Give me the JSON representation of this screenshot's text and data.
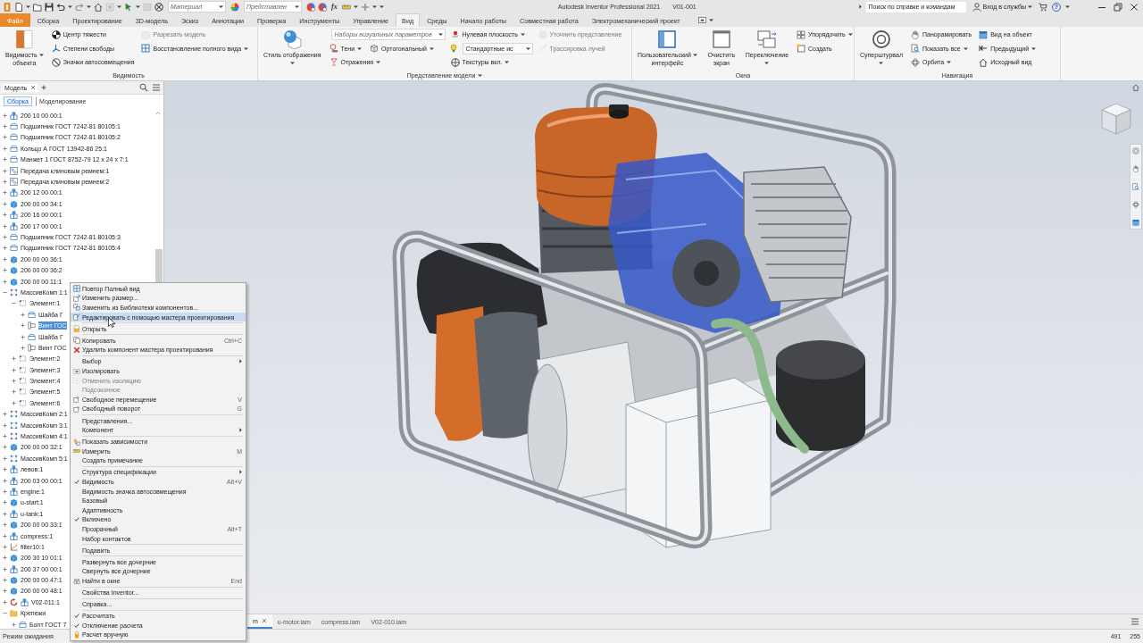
{
  "title_bar": {
    "quick_access": [
      {
        "kind": "button",
        "dropdown": true,
        "disabled": false
      },
      {
        "kind": "button",
        "dropdown": false,
        "disabled": false
      },
      {
        "kind": "button",
        "dropdown": false,
        "disabled": false
      },
      {
        "kind": "button",
        "dropdown": true,
        "disabled": false
      },
      {
        "kind": "button",
        "dropdown": true,
        "disabled": true
      },
      {
        "kind": "button",
        "dropdown": false,
        "disabled": false
      },
      {
        "kind": "button",
        "dropdown": true,
        "disabled": true
      },
      {
        "kind": "button",
        "dropdown": true,
        "disabled": false
      },
      {
        "kind": "button",
        "dropdown": false,
        "disabled": true
      },
      {
        "kind": "button",
        "dropdown": false,
        "disabled": false
      },
      {
        "kind": "combo",
        "placeholder": "Материал",
        "dropdown": true
      },
      {
        "kind": "button",
        "dropdown": false,
        "disabled": false
      },
      {
        "kind": "combo",
        "placeholder": "Представлен",
        "dropdown": true
      },
      {
        "kind": "button",
        "dropdown": false,
        "disabled": false
      },
      {
        "kind": "button",
        "dropdown": false,
        "disabled": false
      },
      {
        "kind": "text",
        "label": "fx"
      },
      {
        "kind": "button",
        "dropdown": true,
        "disabled": false
      },
      {
        "kind": "button",
        "dropdown": true,
        "disabled": true
      },
      {
        "kind": "menu"
      }
    ],
    "title": "Autodesk Inventor Professional 2021",
    "document": "V01-001",
    "search": {
      "placeholder": "Поиск по справке и командам"
    },
    "sign_in": "Вход в службы",
    "help": "?"
  },
  "ribbon_tabs": [
    {
      "label": "Файл",
      "kind": "file",
      "selected": false
    },
    {
      "label": "Сборка",
      "kind": "tab",
      "selected": false
    },
    {
      "label": "Проектирование",
      "kind": "tab",
      "selected": false
    },
    {
      "label": "3D-модель",
      "kind": "tab",
      "selected": false
    },
    {
      "label": "Эскиз",
      "kind": "tab",
      "selected": false
    },
    {
      "label": "Аннотации",
      "kind": "tab",
      "selected": false
    },
    {
      "label": "Проверка",
      "kind": "tab",
      "selected": false
    },
    {
      "label": "Инструменты",
      "kind": "tab",
      "selected": false
    },
    {
      "label": "Управление",
      "kind": "tab",
      "selected": false
    },
    {
      "label": "Вид",
      "kind": "tab",
      "selected": true
    },
    {
      "label": "Среды",
      "kind": "tab",
      "selected": false
    },
    {
      "label": "Начало работы",
      "kind": "tab",
      "selected": false
    },
    {
      "label": "Совместная работа",
      "kind": "tab",
      "selected": false
    },
    {
      "label": "Электромеханический проект",
      "kind": "tab",
      "selected": false
    }
  ],
  "ribbon_panels": [
    {
      "label": "Видимость",
      "dropdown": false,
      "columns": [
        {
          "rows": [
            [
              {
                "kind": "large",
                "lines": [
                  "Видимость",
                  "объекта"
                ],
                "dropdown": true,
                "disabled": false
              }
            ]
          ]
        },
        {
          "rows": [
            [
              {
                "kind": "small",
                "label": "Центр тяжести",
                "dropdown": false,
                "disabled": false
              }
            ],
            [
              {
                "kind": "small",
                "label": "Степени свободы",
                "dropdown": false,
                "disabled": false
              }
            ],
            [
              {
                "kind": "small",
                "label": "Значки автосовмещения",
                "dropdown": false,
                "disabled": false
              }
            ]
          ]
        },
        {
          "rows": [
            [
              {
                "kind": "small",
                "label": "Разрезать модель",
                "dropdown": false,
                "disabled": true
              }
            ],
            [
              {
                "kind": "small",
                "label": "Восстановление полного вида",
                "dropdown": true,
                "disabled": false
              }
            ]
          ]
        }
      ]
    },
    {
      "label": "Представление модели",
      "dropdown": true,
      "columns": [
        {
          "rows": [
            [
              {
                "kind": "large",
                "lines": [
                  "Стиль отображения"
                ],
                "dropdown": true,
                "disabled": false
              }
            ]
          ]
        },
        {
          "rows": [
            [
              {
                "kind": "combo",
                "placeholder": "Наборы визуальных параметров",
                "dropdown": true,
                "disabled": false
              }
            ],
            [
              {
                "kind": "small",
                "label": "Тени",
                "dropdown": true,
                "disabled": false
              },
              {
                "kind": "small",
                "label": "Ортогональный",
                "dropdown": true,
                "disabled": false
              }
            ],
            [
              {
                "kind": "small",
                "label": "Отражения",
                "dropdown": true,
                "disabled": false
              }
            ]
          ]
        },
        {
          "rows": [
            [
              {
                "kind": "small",
                "label": "Нулевая плоскость",
                "dropdown": true,
                "disabled": false
              }
            ],
            [
              {
                "kind": "combo",
                "value": "Стандартные ис",
                "dropdown": true,
                "disabled": false
              }
            ],
            [
              {
                "kind": "small",
                "label": "Текстуры вкл.",
                "dropdown": true,
                "disabled": false
              }
            ]
          ]
        },
        {
          "rows": [
            [
              {
                "kind": "small",
                "label": "Уточнить представление",
                "dropdown": false,
                "disabled": true
              }
            ],
            [
              {
                "kind": "small",
                "label": "Трассировка лучей",
                "dropdown": false,
                "disabled": true
              }
            ]
          ]
        }
      ]
    },
    {
      "label": "Окна",
      "dropdown": false,
      "columns": [
        {
          "rows": [
            [
              {
                "kind": "large",
                "lines": [
                  "Пользовательский",
                  "интерфейс"
                ],
                "dropdown": true,
                "disabled": false
              }
            ]
          ]
        },
        {
          "rows": [
            [
              {
                "kind": "large",
                "lines": [
                  "Очистить",
                  "экран"
                ],
                "dropdown": false,
                "disabled": false
              }
            ]
          ]
        },
        {
          "rows": [
            [
              {
                "kind": "large",
                "lines": [
                  "Переключение"
                ],
                "dropdown": true,
                "disabled": false
              }
            ]
          ]
        },
        {
          "rows": [
            [
              {
                "kind": "small",
                "label": "Упорядочить",
                "dropdown": true,
                "disabled": false
              }
            ],
            [
              {
                "kind": "small",
                "label": "Создать",
                "dropdown": false,
                "disabled": false
              }
            ]
          ]
        }
      ]
    },
    {
      "label": "Навигация",
      "dropdown": false,
      "columns": [
        {
          "rows": [
            [
              {
                "kind": "large",
                "lines": [
                  "Суперштурвал"
                ],
                "dropdown": true,
                "disabled": false
              }
            ]
          ]
        },
        {
          "rows": [
            [
              {
                "kind": "small",
                "label": "Панорамировать",
                "dropdown": false,
                "disabled": false
              }
            ],
            [
              {
                "kind": "small",
                "label": "Показать все",
                "dropdown": true,
                "disabled": false
              }
            ],
            [
              {
                "kind": "small",
                "label": "Орбита",
                "dropdown": true,
                "disabled": false
              }
            ]
          ]
        },
        {
          "rows": [
            [
              {
                "kind": "small",
                "label": "Вид на объект",
                "dropdown": false,
                "disabled": false
              }
            ],
            [
              {
                "kind": "small",
                "label": "Предыдущий",
                "dropdown": true,
                "disabled": false
              }
            ],
            [
              {
                "kind": "small",
                "label": "Исходный вид",
                "dropdown": false,
                "disabled": false
              }
            ]
          ]
        }
      ]
    }
  ],
  "browser": {
    "tabs": [
      {
        "label": "Модель",
        "selected": true
      }
    ],
    "views": [
      {
        "label": "Сборка",
        "selected": true
      },
      {
        "label": "Моделирование",
        "selected": false
      }
    ],
    "tree": [
      {
        "label": "200 10 00 00:1",
        "kind": "assembly",
        "expanded": false,
        "selected": false
      },
      {
        "label": "Подшипник ГОСТ 7242-81 80105:1",
        "kind": "library",
        "expanded": false,
        "selected": false
      },
      {
        "label": "Подшипник ГОСТ 7242-81 80105:2",
        "kind": "library",
        "expanded": false,
        "selected": false
      },
      {
        "label": "Кольцо А ГОСТ 13942-86 25:1",
        "kind": "library",
        "expanded": false,
        "selected": false
      },
      {
        "label": "Манжет 1 ГОСТ 8752-79 12 х 24 х 7:1",
        "kind": "library",
        "expanded": false,
        "selected": false
      },
      {
        "label": "Передача клиновым ремнем:1",
        "kind": "generator",
        "expanded": false,
        "selected": false
      },
      {
        "label": "Передача клиновым ремнем:2",
        "kind": "generator",
        "expanded": false,
        "selected": false
      },
      {
        "label": "200 12 00 00:1",
        "kind": "assembly",
        "expanded": false,
        "selected": false
      },
      {
        "label": "200 00 00 34:1",
        "kind": "part",
        "expanded": false,
        "selected": false
      },
      {
        "label": "200 16 00 00:1",
        "kind": "assembly",
        "expanded": false,
        "selected": false
      },
      {
        "label": "200 17 00 00:1",
        "kind": "assembly",
        "expanded": false,
        "selected": false
      },
      {
        "label": "Подшипник ГОСТ 7242-81 80105:3",
        "kind": "library",
        "expanded": false,
        "selected": false
      },
      {
        "label": "Подшипник ГОСТ 7242-81 80105:4",
        "kind": "library",
        "expanded": false,
        "selected": false
      },
      {
        "label": "200 00 00 36:1",
        "kind": "part",
        "expanded": false,
        "selected": false
      },
      {
        "label": "200 00 00 36:2",
        "kind": "part",
        "expanded": false,
        "selected": false
      },
      {
        "label": "200 00 00 11:1",
        "kind": "part",
        "expanded": false,
        "selected": false
      },
      {
        "label": "МассивКомп 1:1",
        "kind": "pattern",
        "expanded": true,
        "selected": false,
        "children": [
          {
            "label": "Элемент:1",
            "kind": "element",
            "expanded": true,
            "selected": false,
            "children": [
              {
                "label": "Шайба Г",
                "kind": "library",
                "expanded": false,
                "selected": false
              },
              {
                "label": "Винт ГОС",
                "kind": "bolt",
                "expanded": false,
                "selected": true
              },
              {
                "label": "Шайба Г",
                "kind": "library",
                "expanded": false,
                "selected": false
              },
              {
                "label": "Винт ГОС",
                "kind": "bolt",
                "expanded": false,
                "selected": false
              }
            ]
          },
          {
            "label": "Элемент:2",
            "kind": "element",
            "expanded": false,
            "selected": false
          },
          {
            "label": "Элемент:3",
            "kind": "element",
            "expanded": false,
            "selected": false
          },
          {
            "label": "Элемент:4",
            "kind": "element",
            "expanded": false,
            "selected": false
          },
          {
            "label": "Элемент:5",
            "kind": "element",
            "expanded": false,
            "selected": false
          },
          {
            "label": "Элемент:6",
            "kind": "element",
            "expanded": false,
            "selected": false
          }
        ]
      },
      {
        "label": "МассивКомп 2:1",
        "kind": "pattern",
        "expanded": false,
        "selected": false
      },
      {
        "label": "МассивКомп 3:1",
        "kind": "pattern",
        "expanded": false,
        "selected": false
      },
      {
        "label": "МассивКомп 4:1",
        "kind": "pattern",
        "expanded": false,
        "selected": false
      },
      {
        "label": "200 00 00 32:1",
        "kind": "part",
        "expanded": false,
        "selected": false
      },
      {
        "label": "МассивКомп 5:1",
        "kind": "pattern",
        "expanded": false,
        "selected": false
      },
      {
        "label": "левов:1",
        "kind": "assembly",
        "expanded": false,
        "selected": false
      },
      {
        "label": "200 03 00 00:1",
        "kind": "assembly",
        "expanded": false,
        "selected": false
      },
      {
        "label": "engine:1",
        "kind": "assembly",
        "expanded": false,
        "selected": false
      },
      {
        "label": "u-start:1",
        "kind": "part",
        "expanded": false,
        "selected": false
      },
      {
        "label": "u-tank:1",
        "kind": "assembly",
        "expanded": false,
        "selected": false
      },
      {
        "label": "200 00 00 33:1",
        "kind": "part",
        "expanded": false,
        "selected": false
      },
      {
        "label": "compress:1",
        "kind": "assembly",
        "expanded": false,
        "selected": false
      },
      {
        "label": "filter10:1",
        "kind": "curve",
        "expanded": false,
        "selected": false
      },
      {
        "label": "200 30 10 01:1",
        "kind": "part",
        "expanded": false,
        "selected": false
      },
      {
        "label": "200 37 00 00:1",
        "kind": "assembly",
        "expanded": false,
        "selected": false
      },
      {
        "label": "200 00 00 47:1",
        "kind": "part",
        "expanded": false,
        "selected": false
      },
      {
        "label": "200 00 00 48:1",
        "kind": "part",
        "expanded": false,
        "selected": false
      },
      {
        "label": "V02-011:1",
        "kind": "linked",
        "expanded": false,
        "selected": false
      },
      {
        "label": "Крепежи",
        "kind": "folder",
        "expanded": true,
        "selected": false,
        "children": [
          {
            "label": "Болт ГОСТ 7",
            "kind": "library",
            "expanded": false,
            "selected": false
          }
        ]
      }
    ]
  },
  "context_menu": {
    "groups": [
      [
        {
          "label": "Повтор Полный вид",
          "checked": false,
          "disabled": false,
          "selected": false,
          "submenu": false
        },
        {
          "label": "Изменить размер...",
          "checked": false,
          "disabled": false,
          "selected": false,
          "submenu": false
        },
        {
          "label": "Заменить из Библиотеки компонентов...",
          "checked": false,
          "disabled": false,
          "selected": false,
          "submenu": false
        },
        {
          "label": "Редактировать с помощью мастера проектирования",
          "checked": false,
          "disabled": false,
          "selected": true,
          "submenu": false
        }
      ],
      [
        {
          "label": "Открыть",
          "checked": false,
          "disabled": false,
          "selected": false,
          "submenu": false
        }
      ],
      [
        {
          "label": "Копировать",
          "shortcut": "Ctrl+C",
          "checked": false,
          "disabled": false,
          "selected": false,
          "submenu": false
        },
        {
          "label": "Удалить компонент мастера проектирования",
          "checked": false,
          "disabled": false,
          "selected": false,
          "submenu": false
        }
      ],
      [
        {
          "label": "Выбор",
          "checked": false,
          "disabled": false,
          "selected": false,
          "submenu": true
        },
        {
          "label": "Изолировать",
          "checked": false,
          "disabled": false,
          "selected": false,
          "submenu": false
        },
        {
          "label": "Отменить изоляцию",
          "checked": false,
          "disabled": true,
          "selected": false,
          "submenu": false
        },
        {
          "label": "Подсоконное",
          "checked": false,
          "disabled": true,
          "selected": false,
          "submenu": false
        },
        {
          "label": "Свободное перемещение",
          "shortcut": "V",
          "checked": false,
          "disabled": false,
          "selected": false,
          "submenu": false
        },
        {
          "label": "Свободный поворот",
          "shortcut": "G",
          "checked": false,
          "disabled": false,
          "selected": false,
          "submenu": false
        }
      ],
      [
        {
          "label": "Представления...",
          "checked": false,
          "disabled": false,
          "selected": false,
          "submenu": false
        },
        {
          "label": "Компонент",
          "checked": false,
          "disabled": false,
          "selected": false,
          "submenu": true
        }
      ],
      [
        {
          "label": "Показать зависимости",
          "checked": false,
          "disabled": false,
          "selected": false,
          "submenu": false
        },
        {
          "label": "Измерить",
          "shortcut": "M",
          "checked": false,
          "disabled": false,
          "selected": false,
          "submenu": false
        },
        {
          "label": "Создать примечание",
          "checked": false,
          "disabled": false,
          "selected": false,
          "submenu": false
        }
      ],
      [
        {
          "label": "Структура спецификации",
          "checked": false,
          "disabled": false,
          "selected": false,
          "submenu": true
        },
        {
          "label": "Видимость",
          "shortcut": "Alt+V",
          "checked": true,
          "disabled": false,
          "selected": false,
          "submenu": false
        },
        {
          "label": "Видимость значка автосовмещения",
          "checked": false,
          "disabled": false,
          "selected": false,
          "submenu": false
        },
        {
          "label": "Базовый",
          "checked": false,
          "disabled": false,
          "selected": false,
          "submenu": false
        },
        {
          "label": "Адаптивность",
          "checked": false,
          "disabled": false,
          "selected": false,
          "submenu": false
        },
        {
          "label": "Включено",
          "checked": true,
          "disabled": false,
          "selected": false,
          "submenu": false
        },
        {
          "label": "Прозрачный",
          "shortcut": "Alt+T",
          "checked": false,
          "disabled": false,
          "selected": false,
          "submenu": false
        },
        {
          "label": "Набор контактов",
          "checked": false,
          "disabled": false,
          "selected": false,
          "submenu": false
        }
      ],
      [
        {
          "label": "Подавить",
          "checked": false,
          "disabled": false,
          "selected": false,
          "submenu": false
        }
      ],
      [
        {
          "label": "Развернуть все дочерние",
          "checked": false,
          "disabled": false,
          "selected": false,
          "submenu": false
        },
        {
          "label": "Свернуть все дочерние",
          "checked": false,
          "disabled": false,
          "selected": false,
          "submenu": false
        },
        {
          "label": "Найти в окне",
          "shortcut": "End",
          "checked": false,
          "disabled": false,
          "selected": false,
          "submenu": false
        }
      ],
      [
        {
          "label": "Свойства Inventor...",
          "checked": false,
          "disabled": false,
          "selected": false,
          "submenu": false
        }
      ],
      [
        {
          "label": "Справка...",
          "checked": false,
          "disabled": false,
          "selected": false,
          "submenu": false
        }
      ],
      [
        {
          "label": "Рассчитать",
          "checked": true,
          "disabled": false,
          "selected": false,
          "submenu": false
        },
        {
          "label": "Отключение расчета",
          "checked": true,
          "disabled": false,
          "selected": false,
          "submenu": false
        },
        {
          "label": "Расчет вручную",
          "checked": false,
          "disabled": false,
          "selected": false,
          "submenu": false
        }
      ]
    ]
  },
  "document_tabs": [
    {
      "label": "m",
      "selected": true
    },
    {
      "label": "u-motor.iam",
      "selected": false
    },
    {
      "label": "compress.iam",
      "selected": false
    },
    {
      "label": "V02-010.iam",
      "selected": false
    }
  ],
  "status_bar": {
    "message": "Режим ожидания",
    "readouts": [
      "491",
      "255"
    ]
  }
}
